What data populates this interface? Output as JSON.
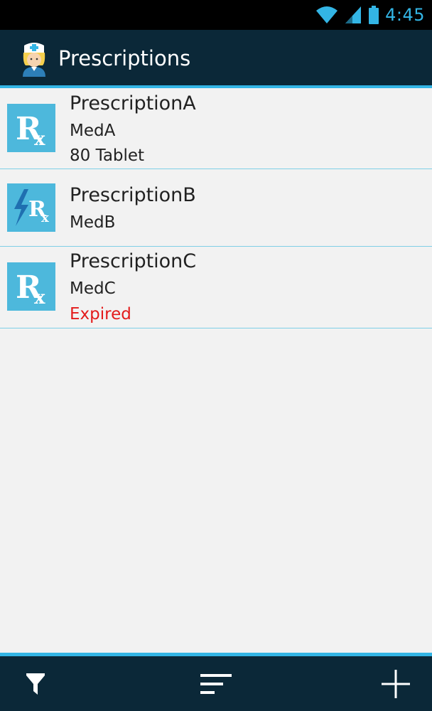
{
  "status_bar": {
    "time": "4:45",
    "icons": [
      "wifi-icon",
      "signal-icon",
      "battery-icon"
    ]
  },
  "action_bar": {
    "title": "Prescriptions",
    "icon": "nurse-icon"
  },
  "prescriptions": [
    {
      "name": "PrescriptionA",
      "med": "MedA",
      "extra": "80 Tablet",
      "icon": "rx-icon"
    },
    {
      "name": "PrescriptionB",
      "med": "MedB",
      "icon": "rx-lightning-icon"
    },
    {
      "name": "PrescriptionC",
      "med": "MedC",
      "extra": "Expired",
      "icon": "rx-icon"
    }
  ],
  "bottom_bar": {
    "actions": [
      "filter-icon",
      "sort-icon",
      "add-icon"
    ]
  },
  "colors": {
    "accent": "#33b5e5",
    "bar_background": "#0b2838",
    "expired": "#e31b1b",
    "list_background": "#f2f2f2"
  }
}
